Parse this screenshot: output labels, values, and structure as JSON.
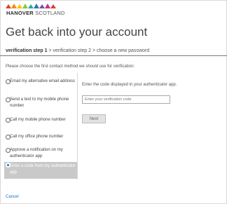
{
  "brand": {
    "name_bold": "HANOVER",
    "name_light": "SCOTLAND"
  },
  "page": {
    "title": "Get back into your account"
  },
  "steps": {
    "step1": "verification step 1",
    "step2": "verification step 2",
    "step3": "choose a new password",
    "separator": ">"
  },
  "contact_prompt": "Please choose the first contact method we should use for verification:",
  "options": [
    {
      "label": "Email my alternative email address",
      "selected": false
    },
    {
      "label": "Send a text to my mobile phone number",
      "selected": false
    },
    {
      "label": "Call my mobile phone number",
      "selected": false
    },
    {
      "label": "Call my office phone number",
      "selected": false
    },
    {
      "label": "Approve a notification on my authenticator app",
      "selected": false
    },
    {
      "label": "Enter a code from my authenticator app",
      "selected": true
    }
  ],
  "detail": {
    "prompt": "Enter the code displayed in your authenticator app.",
    "code_placeholder": "Enter your verification code",
    "next_label": "Next"
  },
  "footer": {
    "cancel_label": "Cancel"
  },
  "colors": {
    "accent": "#1a73c9",
    "selected_bg": "#c9c9c9"
  }
}
